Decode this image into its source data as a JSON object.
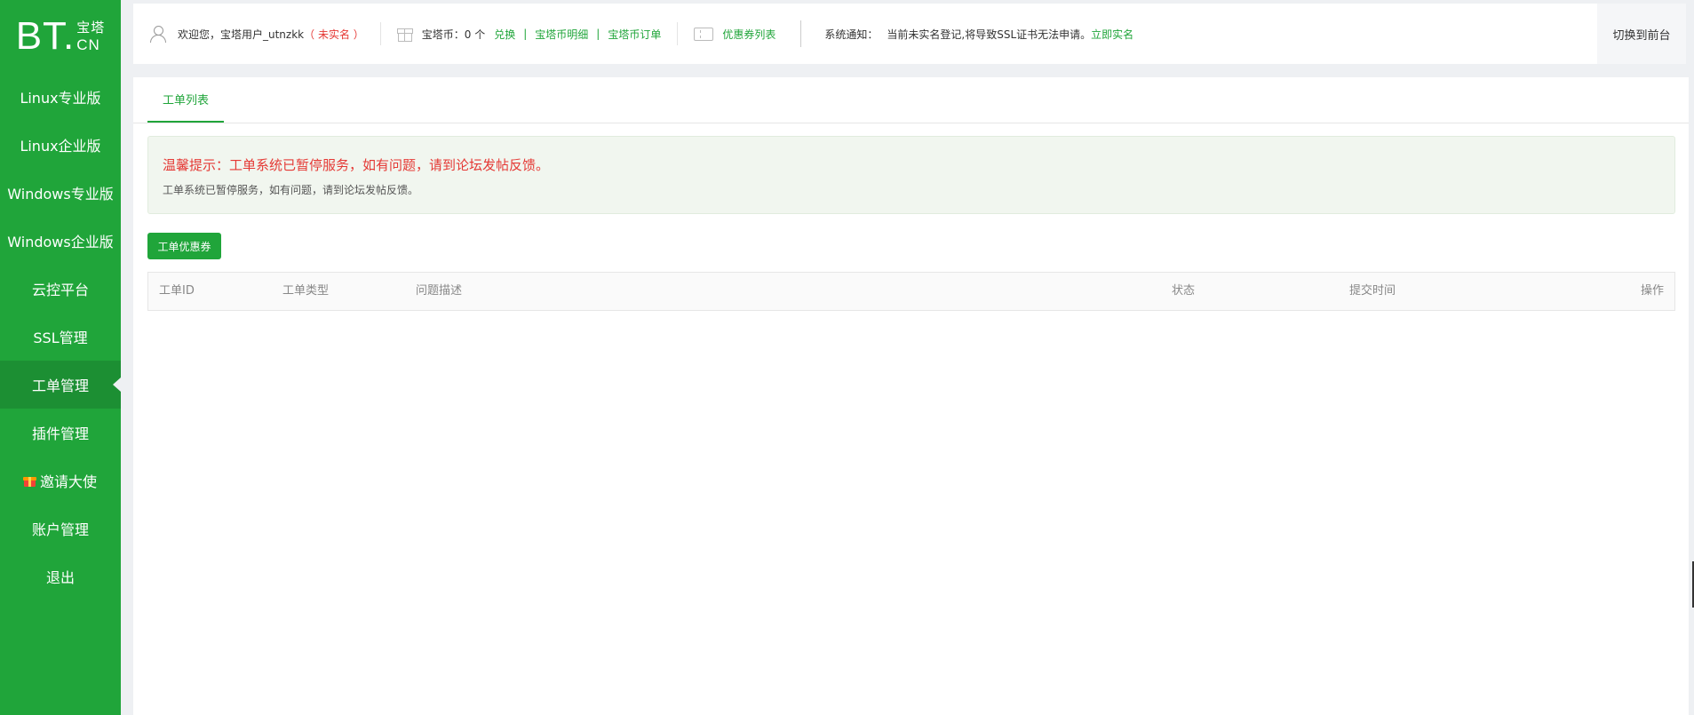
{
  "logo": {
    "main": "BT",
    "dot": ".",
    "cn_top": "宝塔",
    "cn_bottom": "CN"
  },
  "sidebar": {
    "items": [
      {
        "label": "Linux专业版"
      },
      {
        "label": "Linux企业版"
      },
      {
        "label": "Windows专业版"
      },
      {
        "label": "Windows企业版"
      },
      {
        "label": "云控平台"
      },
      {
        "label": "SSL管理"
      },
      {
        "label": "工单管理",
        "active": true
      },
      {
        "label": "插件管理"
      },
      {
        "label": "邀请大使",
        "icon": "gift-icon"
      },
      {
        "label": "账户管理"
      },
      {
        "label": "退出"
      }
    ]
  },
  "header": {
    "welcome": "欢迎您，宝塔用户_utnzkk",
    "unverified": "（ 未实名 ）",
    "coins": "宝塔币：0 个",
    "exchange": "兑换",
    "coin_detail": "宝塔币明细",
    "coin_orders": "宝塔币订单",
    "coupon_list": "优惠券列表",
    "notice_label": "系统通知：",
    "notice_text": "当前未实名登记,将导致SSL证书无法申请。",
    "verify_link": "立即实名",
    "switch": "切换到前台",
    "separator": "|"
  },
  "tabs": [
    {
      "label": "工单列表"
    }
  ],
  "notice": {
    "title": "温馨提示：工单系统已暂停服务，如有问题，请到论坛发帖反馈。",
    "desc": "工单系统已暂停服务，如有问题，请到论坛发帖反馈。"
  },
  "toolbar": {
    "coupon_button": "工单优惠券"
  },
  "table": {
    "columns": [
      "工单ID",
      "工单类型",
      "问题描述",
      "状态",
      "提交时间",
      "操作"
    ]
  },
  "colors": {
    "accent": "#20a53a",
    "sidebar_active": "#1c8f33",
    "warning": "#e53935"
  }
}
